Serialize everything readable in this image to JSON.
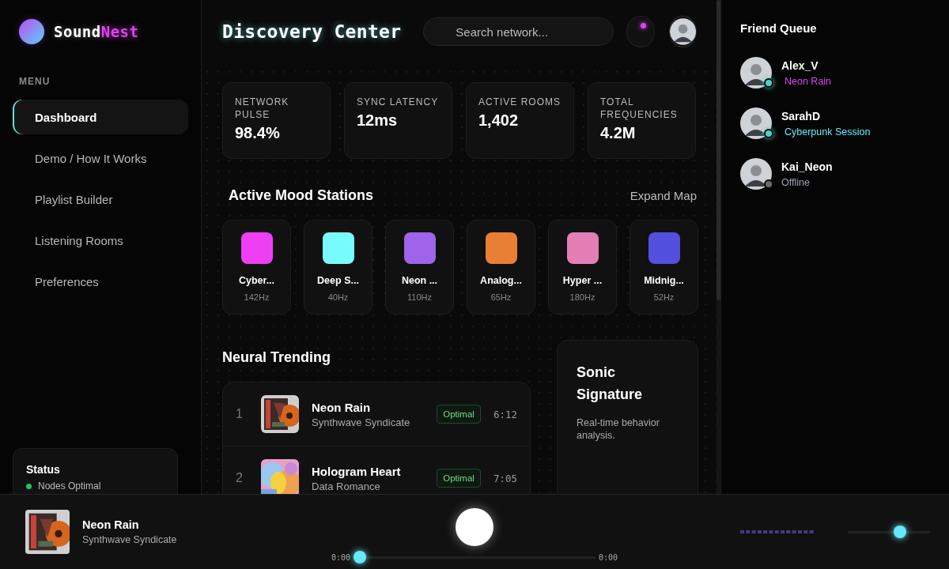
{
  "brand": {
    "name_part_1": "Sound",
    "name_part_2": "Nest"
  },
  "sidebar": {
    "heading": "MENU",
    "items": [
      {
        "label": "Dashboard",
        "selected": true
      },
      {
        "label": "Demo / How It Works",
        "selected": false
      },
      {
        "label": "Playlist Builder",
        "selected": false
      },
      {
        "label": "Listening Rooms",
        "selected": false
      },
      {
        "label": "Preferences",
        "selected": false
      }
    ],
    "status": {
      "title": "Status",
      "text": "Nodes Optimal",
      "ok": true
    }
  },
  "header": {
    "title": "Discovery Center",
    "search": {
      "placeholder": "Search network..."
    },
    "notifications": {
      "unread": true
    }
  },
  "stats": [
    {
      "label": "NETWORK PULSE",
      "value": "98.4%"
    },
    {
      "label": "SYNC LATENCY",
      "value": "12ms"
    },
    {
      "label": "ACTIVE ROOMS",
      "value": "1,402"
    },
    {
      "label": "TOTAL FREQUENCIES",
      "value": "4.2M"
    }
  ],
  "mood_stations": {
    "title": "Active Mood Stations",
    "action": "Expand Map",
    "items": [
      {
        "name": "Cyber...",
        "frequency": "142Hz",
        "color": "#ee3ff5"
      },
      {
        "name": "Deep S...",
        "frequency": "40Hz",
        "color": "#77fbfd"
      },
      {
        "name": "Neon ...",
        "frequency": "110Hz",
        "color": "#9f64ea"
      },
      {
        "name": "Analog...",
        "frequency": "65Hz",
        "color": "#e97f35"
      },
      {
        "name": "Hyper ...",
        "frequency": "180Hz",
        "color": "#e37fb5"
      },
      {
        "name": "Midnig...",
        "frequency": "52Hz",
        "color": "#5350dd"
      }
    ]
  },
  "trending": {
    "title": "Neural Trending",
    "rows": [
      {
        "rank": "1",
        "title": "Neon Rain",
        "artist": "Synthwave Syndicate",
        "badge": "Optimal",
        "duration": "6:12"
      },
      {
        "rank": "2",
        "title": "Hologram Heart",
        "artist": "Data Romance",
        "badge": "Optimal",
        "duration": "7:05"
      }
    ]
  },
  "sonic_signature": {
    "title": "Sonic Signature",
    "text": "Real-time behavior analysis."
  },
  "friend_queue": {
    "title": "Friend Queue",
    "friends": [
      {
        "name": "Alex_V",
        "activity": "Neon Rain",
        "online": true,
        "color": "#d946ef"
      },
      {
        "name": "SarahD",
        "activity": "Cyberpunk Session",
        "online": true,
        "color": "#67e8f9"
      },
      {
        "name": "Kai_Neon",
        "activity": "Offline",
        "online": false,
        "color": "#9ca3af"
      }
    ]
  },
  "player": {
    "title": "Neon Rain",
    "artist": "Synthwave Syndicate",
    "elapsed": "0:00",
    "total": "0:00",
    "level": 0,
    "volume": {
      "level": 0.66
    }
  }
}
